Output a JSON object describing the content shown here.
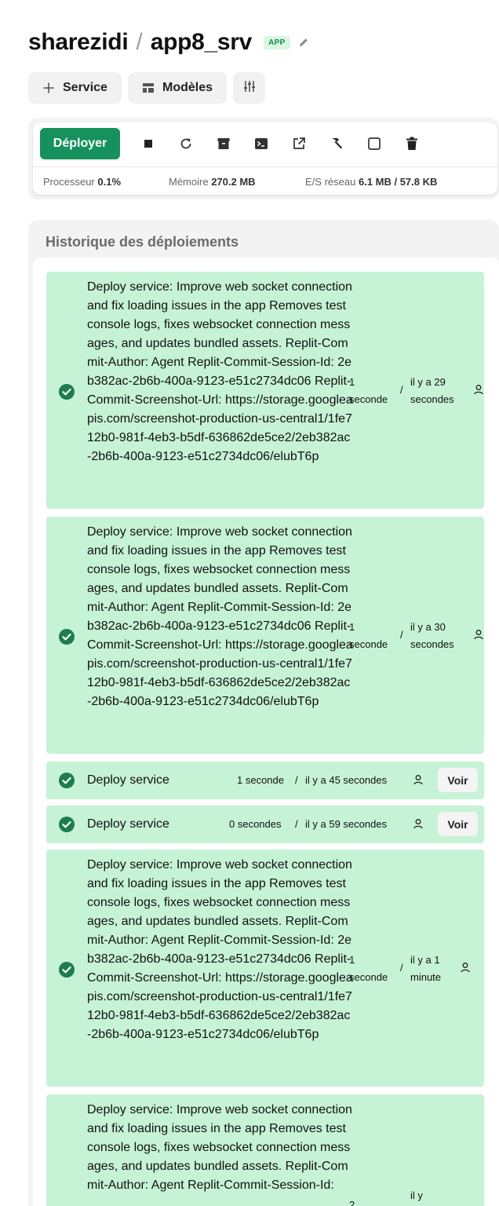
{
  "header": {
    "owner": "sharezidi",
    "separator": "/",
    "app_name": "app8_srv",
    "badge": "APP"
  },
  "toolbar": {
    "service_label": "Service",
    "models_label": "Modèles"
  },
  "controls": {
    "deploy_label": "Déployer",
    "icons": [
      "stop-icon",
      "restart-icon",
      "archive-icon",
      "terminal-icon",
      "open-external-icon",
      "build-hammer-icon",
      "square-icon",
      "trash-icon"
    ]
  },
  "stats": {
    "cpu_label": "Processeur",
    "cpu_value": "0.1%",
    "mem_label": "Mémoire",
    "mem_value": "270.2 MB",
    "net_label": "E/S réseau",
    "net_value": "6.1 MB / 57.8 KB"
  },
  "history": {
    "title": "Historique des déploiements",
    "deployments": [
      {
        "message": "Deploy service: Improve web socket connection and fix loading issues in the app Removes test console logs, fixes websocket connection messages, and updates bundled assets. Replit-Commit-Author: Agent Replit-Commit-Session-Id: 2eb382ac-2b6b-400a-9123-e51c2734dc06 Replit-Commit-Screenshot-Url: https://storage.googleapis.com/screenshot-production-us-central1/1fe712b0-981f-4eb3-b5df-636862de5ce2/2eb382ac-2b6b-400a-9123-e51c2734dc06/elubT6p",
        "duration": "1 seconde",
        "ago": "il y a 29 secondes"
      },
      {
        "message": "Deploy service: Improve web socket connection and fix loading issues in the app Removes test console logs, fixes websocket connection messages, and updates bundled assets. Replit-Commit-Author: Agent Replit-Commit-Session-Id: 2eb382ac-2b6b-400a-9123-e51c2734dc06 Replit-Commit-Screenshot-Url: https://storage.googleapis.com/screenshot-production-us-central1/1fe712b0-981f-4eb3-b5df-636862de5ce2/2eb382ac-2b6b-400a-9123-e51c2734dc06/elubT6p",
        "duration": "1 seconde",
        "ago": "il y a 30 secondes"
      },
      {
        "message": "Deploy service",
        "duration": "1 seconde",
        "ago": "il y a 45 secondes",
        "action": "Voir"
      },
      {
        "message": "Deploy service",
        "duration": "0 secondes",
        "ago": "il y a 59 secondes",
        "action": "Voir"
      },
      {
        "message": "Deploy service: Improve web socket connection and fix loading issues in the app Removes test console logs, fixes websocket connection messages, and updates bundled assets. Replit-Commit-Author: Agent Replit-Commit-Session-Id: 2eb382ac-2b6b-400a-9123-e51c2734dc06 Replit-Commit-Screenshot-Url: https://storage.googleapis.com/screenshot-production-us-central1/1fe712b0-981f-4eb3-b5df-636862de5ce2/2eb382ac-2b6b-400a-9123-e51c2734dc06/elubT6p",
        "duration": "1 seconde",
        "ago": "il y a 1 minute"
      },
      {
        "message": "Deploy service: Improve web socket connection and fix loading issues in the app Removes test console logs, fixes websocket connection messages, and updates bundled assets. Replit-Commit-Author: Agent Replit-Commit-Session-Id:",
        "duration": "2",
        "ago": "il y"
      }
    ]
  }
}
